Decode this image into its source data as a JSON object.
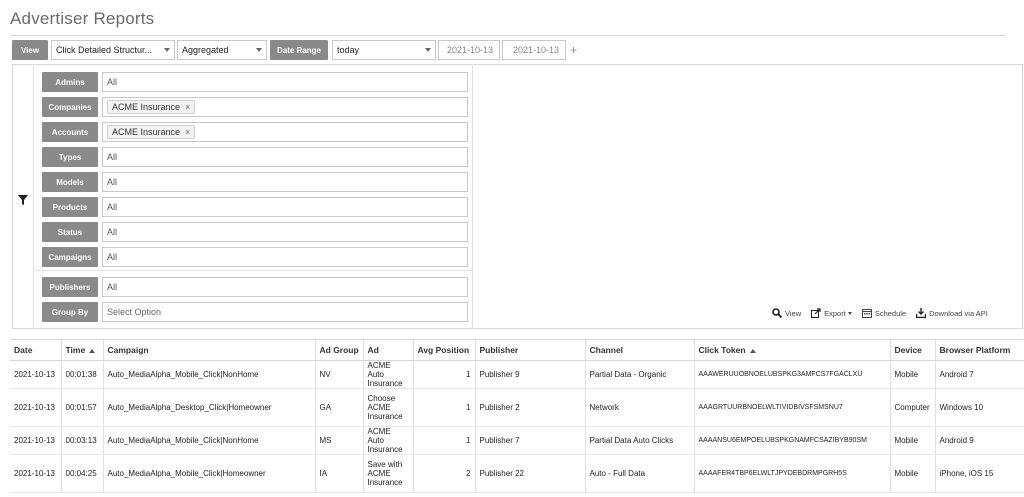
{
  "page": {
    "title": "Advertiser Reports"
  },
  "toolbar": {
    "view_label": "View",
    "report_type": "Click Detailed Structur...",
    "aggregation": "Aggregated",
    "date_range_label": "Date Range",
    "date_preset": "today",
    "date_from": "2021-10-13",
    "date_to": "2021-10-13",
    "add_symbol": "+"
  },
  "filters": [
    {
      "label": "Admins",
      "value": "All"
    },
    {
      "label": "Companies",
      "chip": "ACME Insurance"
    },
    {
      "label": "Accounts",
      "chip": "ACME Insurance"
    },
    {
      "label": "Types",
      "value": "All"
    },
    {
      "label": "Models",
      "value": "All"
    },
    {
      "label": "Products",
      "value": "All"
    },
    {
      "label": "Status",
      "value": "All"
    },
    {
      "label": "Campaigns",
      "value": "All"
    },
    {
      "label": "Publishers",
      "value": "All"
    },
    {
      "label": "Group By",
      "placeholder": "Select Option"
    }
  ],
  "chip_remove": "×",
  "actions": {
    "view": "View",
    "export": "Export",
    "schedule": "Schedule",
    "download": "Download via API"
  },
  "table": {
    "columns": [
      "Date",
      "Time",
      "Campaign",
      "Ad Group",
      "Ad",
      "Avg Position",
      "Publisher",
      "Channel",
      "Click Token",
      "Device",
      "Browser Platform"
    ],
    "sorted_columns": [
      "Time",
      "Click Token"
    ],
    "rows": [
      [
        "2021-10-13",
        "00:01:38",
        "Auto_MediaAlpha_Mobile_Click|NonHome",
        "NV",
        "ACME Auto Insurance",
        "1",
        "Publisher 9",
        "Partial Data - Organic",
        "AAAWERUUOBNOELUBSPKG3AMFCS7FGACLXU",
        "Mobile",
        "Android 7"
      ],
      [
        "2021-10-13",
        "00:01:57",
        "Auto_MediaAlpha_Desktop_Click|Homeowner",
        "GA",
        "Choose ACME Insurance",
        "1",
        "Publisher 2",
        "Network",
        "AAAGRTUURBNOELWLTIVIDBIVSFSMSNU7",
        "Computer",
        "Windows 10"
      ],
      [
        "2021-10-13",
        "00:03:13",
        "Auto_MediaAlpha_Mobile_Click|NonHome",
        "MS",
        "ACME Auto Insurance",
        "1",
        "Publisher 7",
        "Partial Data Auto Clicks",
        "AAAANSU6EMPOELUBSPKGNAMFCSAZIBYB90SM",
        "Mobile",
        "Android 9"
      ],
      [
        "2021-10-13",
        "00:04:25",
        "Auto_MediaAlpha_Mobile_Click|Homeowner",
        "IA",
        "Save with ACME Insurance",
        "2",
        "Publisher 22",
        "Auto - Full Data",
        "AAAAFER4TBP6ELWLTJPYDEBDRMPGRH5S",
        "Mobile",
        "iPhone, iOS 15"
      ]
    ]
  },
  "colors": {
    "label_bg": "#8a8a8a",
    "border": "#c9c9c9",
    "title": "#6a6a6a"
  }
}
